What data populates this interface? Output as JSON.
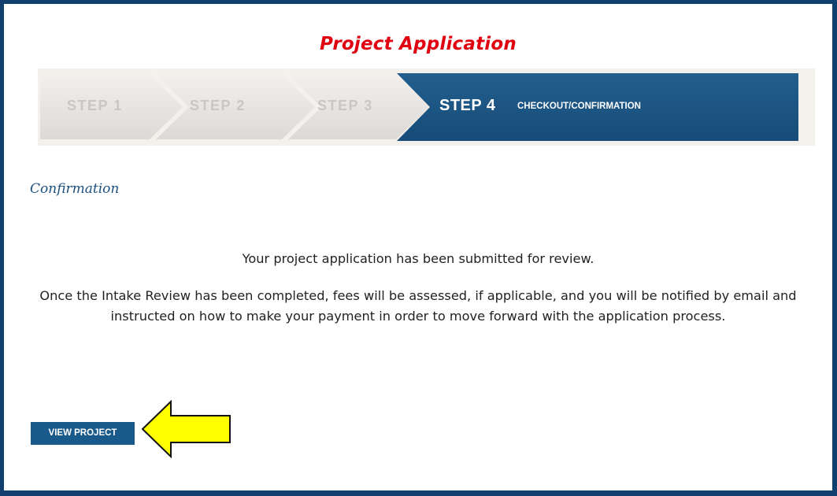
{
  "page": {
    "title": "Project Application",
    "section_heading": "Confirmation",
    "message_primary": "Your project application has been submitted for review.",
    "message_secondary": "Once the Intake Review has been completed, fees will be assessed, if applicable, and you will be notified by email and instructed on how to make your payment in order to move forward with the application process."
  },
  "steps": {
    "step1": "STEP 1",
    "step2": "STEP 2",
    "step3": "STEP 3",
    "step4": "STEP 4",
    "step4_desc": "CHECKOUT/CONFIRMATION",
    "current_step": 4
  },
  "actions": {
    "view_project_label": "VIEW PROJECT"
  },
  "colors": {
    "frame": "#12406e",
    "title": "#e0000f",
    "active_step": "#1b5c8d",
    "button": "#1a5a8a",
    "arrow_fill": "#ffff00"
  },
  "icons": {
    "pointer": "arrow-left-icon"
  }
}
